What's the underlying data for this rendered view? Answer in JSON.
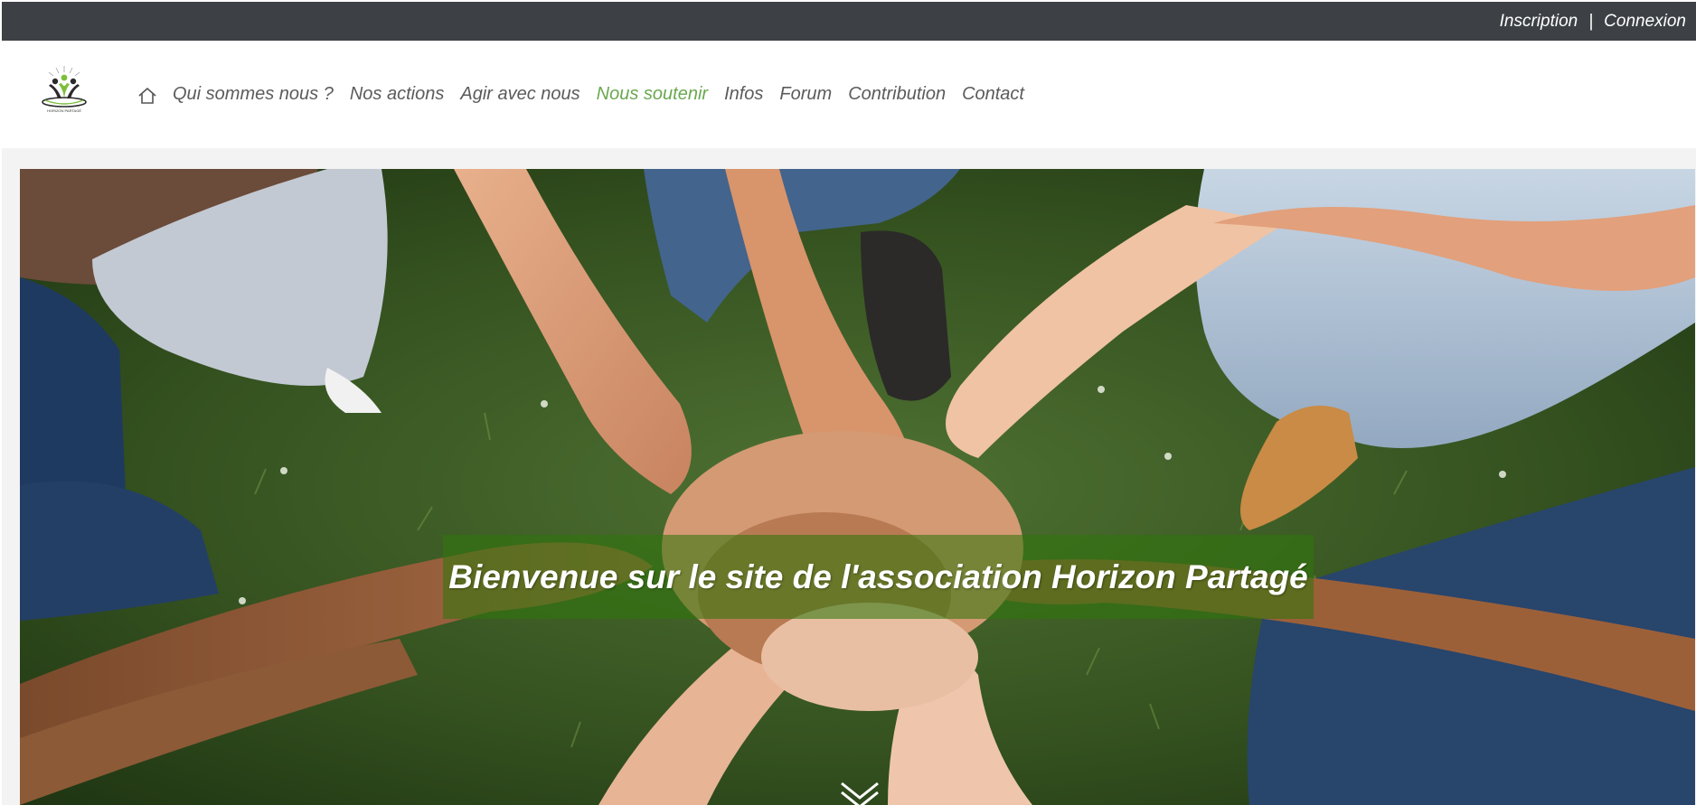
{
  "topbar": {
    "signup_label": "Inscription",
    "separator": "|",
    "login_label": "Connexion"
  },
  "header": {
    "logo_text": "HORIZON PARTAGÉ",
    "nav": {
      "home_icon": "home-icon",
      "items": [
        {
          "label": "Qui sommes nous ?"
        },
        {
          "label": "Nos actions"
        },
        {
          "label": "Agir avec nous"
        },
        {
          "label": "Nous soutenir",
          "active": true
        },
        {
          "label": "Infos"
        },
        {
          "label": "Forum"
        },
        {
          "label": "Contribution"
        },
        {
          "label": "Contact"
        }
      ]
    }
  },
  "hero": {
    "image": "hands-together-on-grass-photo",
    "banner_text": "Bienvenue sur le site de l'association Horizon Partagé",
    "scroll_icon": "chevron-down-icon"
  },
  "colors": {
    "topbar_bg": "#3d4145",
    "nav_text": "#5b5b5b",
    "nav_active": "#6aa84f",
    "banner_bg": "rgba(48,118,12,0.58)"
  }
}
